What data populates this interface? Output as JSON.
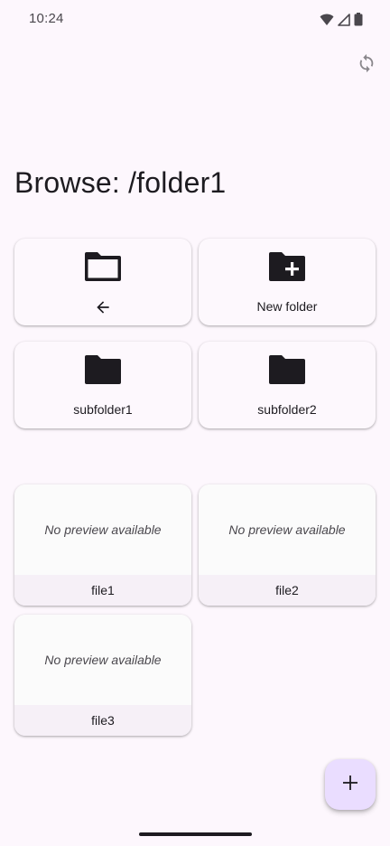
{
  "status_bar": {
    "time": "10:24",
    "icons": [
      "wifi-icon",
      "signal-icon",
      "battery-icon"
    ]
  },
  "toolbar": {
    "sync_icon": "sync-icon"
  },
  "page": {
    "title": "Browse: /folder1"
  },
  "folders": [
    {
      "name": "parent",
      "icon": "folder-outline-icon",
      "label": "",
      "action_icon": "arrow-back-icon"
    },
    {
      "name": "new-folder",
      "icon": "create-new-folder-icon",
      "label": "New folder"
    },
    {
      "name": "subfolder1",
      "icon": "folder-icon",
      "label": "subfolder1"
    },
    {
      "name": "subfolder2",
      "icon": "folder-icon",
      "label": "subfolder2"
    }
  ],
  "files": [
    {
      "preview_text": "No preview available",
      "name": "file1"
    },
    {
      "preview_text": "No preview available",
      "name": "file2"
    },
    {
      "preview_text": "No preview available",
      "name": "file3"
    }
  ],
  "fab": {
    "icon": "add-icon"
  },
  "colors": {
    "background": "#fdf7fd",
    "fab": "#eaddff",
    "icon": "#1d1b20",
    "file_label_bg": "#f6f0f7"
  }
}
